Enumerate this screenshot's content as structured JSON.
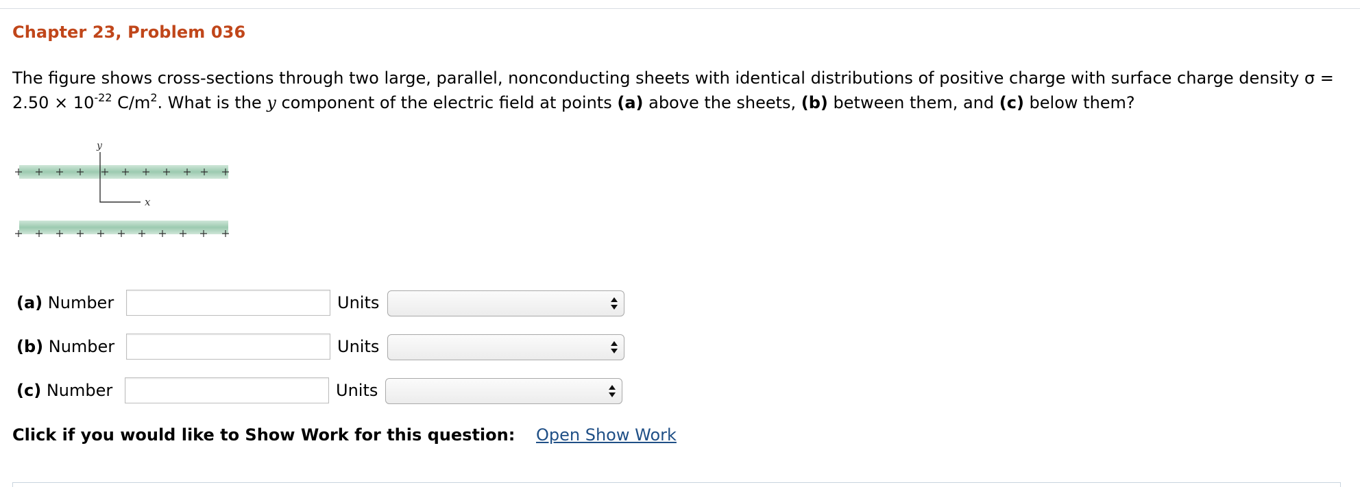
{
  "title": "Chapter 23, Problem 036",
  "question": {
    "part1": "The figure shows cross-sections through two large, parallel, nonconducting sheets with identical distributions of positive charge with surface charge density σ = 2.50 × 10",
    "exponent": "-22",
    "part2": " C/m",
    "units_exponent": "2",
    "part3": ". What is the ",
    "var_y": "y",
    "part4": " component of the electric field at points ",
    "a_tag": "(a)",
    "part5": " above the sheets, ",
    "b_tag": "(b)",
    "part6": " between them, and ",
    "c_tag": "(c)",
    "part7": " below them?"
  },
  "figure": {
    "y_axis_label": "y",
    "x_axis_label": "x",
    "sheet_color": "#9ccab0",
    "charge_symbol": "+"
  },
  "answers": [
    {
      "tag": "(a)",
      "number_label": "Number",
      "number_value": "",
      "units_label": "Units",
      "units_value": ""
    },
    {
      "tag": "(b)",
      "number_label": "Number",
      "number_value": "",
      "units_label": "Units",
      "units_value": ""
    },
    {
      "tag": "(c)",
      "number_label": "Number",
      "number_value": "",
      "units_label": "Units",
      "units_value": ""
    }
  ],
  "show_work": {
    "prompt": "Click if you would like to Show Work for this question:",
    "link": "Open Show Work"
  },
  "colors": {
    "title": "#c0461a",
    "link": "#1f4f86"
  }
}
